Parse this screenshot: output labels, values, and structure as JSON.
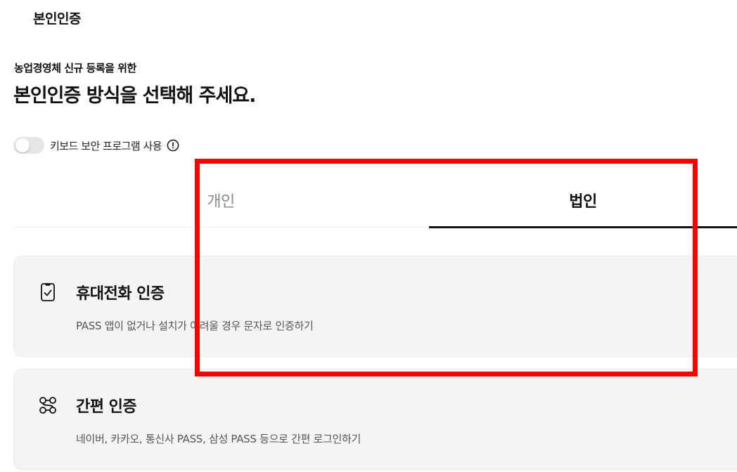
{
  "header": {
    "title": "본인인증"
  },
  "intro": {
    "subtitle": "농업경영체 신규 등록을 위한",
    "headline": "본인인증 방식을 선택해 주세요."
  },
  "keyboard_security": {
    "label": "키보드 보안 프로그램 사용",
    "enabled": false,
    "icon": "info-icon"
  },
  "tabs": [
    {
      "label": "개인",
      "selected": false
    },
    {
      "label": "법인",
      "selected": true
    }
  ],
  "methods": [
    {
      "icon": "mobile-phone-check-icon",
      "title": "휴대전화 인증",
      "description": "PASS 앱이 없거나 설치가 어려울 경우 문자로 인증하기"
    },
    {
      "icon": "network-nodes-icon",
      "title": "간편 인증",
      "description": "네이버, 카카오, 통신사 PASS, 삼성 PASS 등으로 간편 로그인하기"
    }
  ],
  "colors": {
    "accent": "#111111",
    "muted_tab": "#8a8a8a",
    "card_bg": "#f4f4f4",
    "highlight": "#ff0000"
  }
}
